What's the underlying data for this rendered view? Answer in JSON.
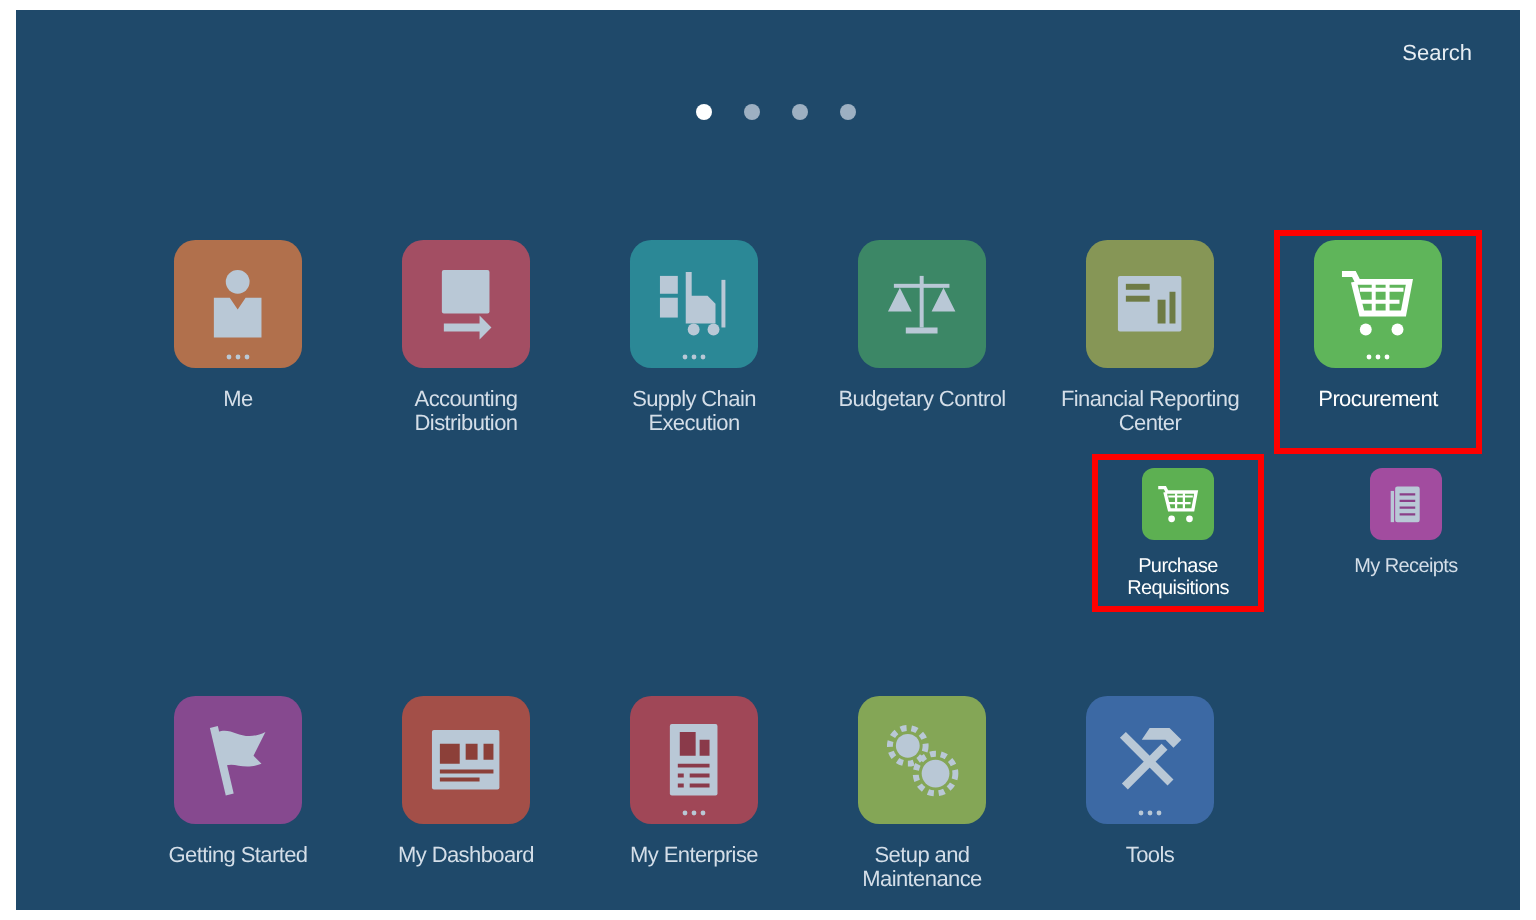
{
  "search": {
    "label": "Search"
  },
  "pager": [
    {
      "selected": true
    },
    {
      "selected": false
    },
    {
      "selected": false
    },
    {
      "selected": false
    }
  ],
  "rows": [
    {
      "kind": "main",
      "tiles": [
        {
          "label": "Me",
          "color": "#b1704c",
          "highlighted": false,
          "more": true
        },
        {
          "label": "Accounting Distribution",
          "color": "#a34e63",
          "highlighted": false,
          "more": false
        },
        {
          "label": "Supply Chain Execution",
          "color": "#2b8896",
          "highlighted": false,
          "more": true
        },
        {
          "label": "Budgetary Control",
          "color": "#3c8766",
          "highlighted": false,
          "more": false
        },
        {
          "label": "Financial Reporting Center",
          "color": "#869656",
          "highlighted": false,
          "more": false
        },
        {
          "label": "Procurement",
          "color": "#5fb55a",
          "highlighted": true,
          "more": true
        }
      ]
    },
    {
      "kind": "sub",
      "tiles": [
        {
          "label": "Purchase Requisitions",
          "color": "#5db052",
          "highlighted": true,
          "more": false
        },
        {
          "label": "My Receipts",
          "color": "#a24c9f",
          "highlighted": false,
          "more": false
        }
      ]
    },
    {
      "kind": "main",
      "tiles": [
        {
          "label": "Getting Started",
          "color": "#86498f",
          "highlighted": false,
          "more": false
        },
        {
          "label": "My Dashboard",
          "color": "#a34f48",
          "highlighted": false,
          "more": false
        },
        {
          "label": "My Enterprise",
          "color": "#a04757",
          "highlighted": false,
          "more": true
        },
        {
          "label": "Setup and Maintenance",
          "color": "#84a656",
          "highlighted": false,
          "more": false
        },
        {
          "label": "Tools",
          "color": "#3c69a4",
          "highlighted": false,
          "more": true
        }
      ]
    }
  ]
}
